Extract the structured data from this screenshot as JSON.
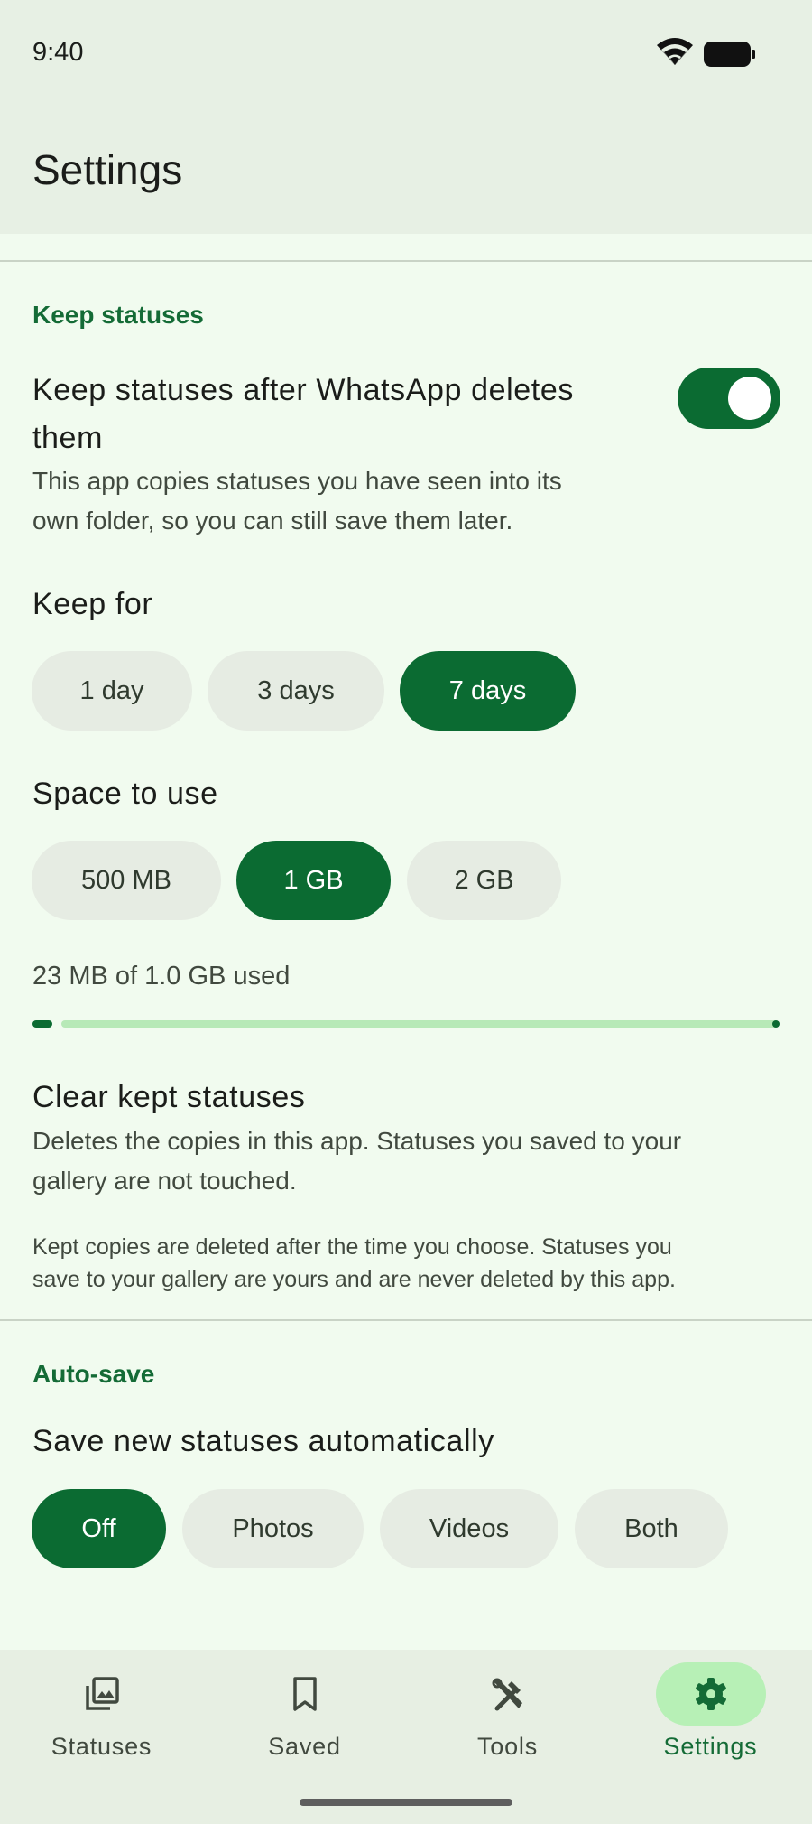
{
  "status_bar": {
    "time": "9:40",
    "wifi_icon": "wifi-icon",
    "battery_icon": "battery-icon"
  },
  "app_bar": {
    "title": "Settings"
  },
  "keep_statuses": {
    "header": "Keep statuses",
    "toggle_title_line1": "Keep statuses after WhatsApp deletes",
    "toggle_title_line2": "them",
    "toggle_summary_line1": "This app copies statuses you have seen into its",
    "toggle_summary_line2": "own folder, so you can still save them later.",
    "toggle_on": true,
    "keep_for": {
      "label": "Keep for",
      "options": [
        "1 day",
        "3 days",
        "7 days"
      ],
      "selected": "7 days"
    },
    "space": {
      "label": "Space to use",
      "options": [
        "500 MB",
        "1 GB",
        "2 GB"
      ],
      "selected": "1 GB"
    },
    "usage": {
      "text": "23 MB of 1.0 GB used",
      "fraction": 0.023
    },
    "clear": {
      "title": "Clear kept statuses",
      "summary_line1": "Deletes the copies in this app. Statuses you saved to your",
      "summary_line2": "gallery are not touched."
    },
    "note_line1": "Kept copies are deleted after the time you choose. Statuses you",
    "note_line2": "save to your gallery are yours and are never deleted by this app."
  },
  "auto_save": {
    "header": "Auto-save",
    "title": "Save new statuses automatically",
    "options": [
      "Off",
      "Photos",
      "Videos",
      "Both"
    ],
    "selected": "Off"
  },
  "bottom_nav": {
    "items": [
      {
        "label": "Statuses",
        "icon": "photo-library-icon",
        "active": false
      },
      {
        "label": "Saved",
        "icon": "bookmark-icon",
        "active": false
      },
      {
        "label": "Tools",
        "icon": "tools-icon",
        "active": false
      },
      {
        "label": "Settings",
        "icon": "gear-icon",
        "active": true
      }
    ]
  },
  "colors": {
    "accent": "#0b6b32",
    "header": "#146b36",
    "background": "#f1fbef",
    "chip": "#e6ece3",
    "nav_indicator": "#b7f0b6"
  }
}
